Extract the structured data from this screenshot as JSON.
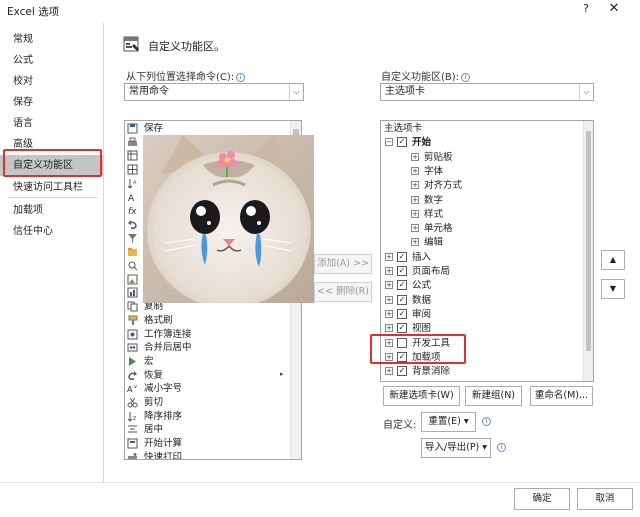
{
  "window": {
    "title": "Excel 选项",
    "help": "?",
    "close": "✕"
  },
  "sidebar": {
    "items": [
      {
        "label": "常规"
      },
      {
        "label": "公式"
      },
      {
        "label": "校对"
      },
      {
        "label": "保存"
      },
      {
        "label": "语言"
      },
      {
        "label": "高级"
      },
      {
        "label": "自定义功能区"
      },
      {
        "label": "快速访问工具栏"
      },
      {
        "label": "加载项"
      },
      {
        "label": "信任中心"
      }
    ],
    "active_index": 6
  },
  "header": {
    "title": "自定义功能区。",
    "icon": "customize-ribbon-icon"
  },
  "left_panel": {
    "label": "从下列位置选择命令(C):",
    "dropdown_value": "常用命令",
    "commands": [
      {
        "label": "保存",
        "icon": "save-icon"
      },
      {
        "label": "",
        "icon": "print-icon"
      },
      {
        "label": "",
        "icon": "table-icon"
      },
      {
        "label": "",
        "icon": "grid-icon"
      },
      {
        "label": "",
        "icon": "sort-icon"
      },
      {
        "label": "",
        "icon": "text-icon"
      },
      {
        "label": "",
        "icon": "function-icon"
      },
      {
        "label": "",
        "icon": "undo-icon"
      },
      {
        "label": "",
        "icon": "filter-icon"
      },
      {
        "label": "",
        "icon": "folder-icon"
      },
      {
        "label": "",
        "icon": "preview-icon"
      },
      {
        "label": "",
        "icon": "image-icon"
      },
      {
        "label": "",
        "icon": "chart-icon"
      },
      {
        "label": "复制",
        "icon": "copy-icon"
      },
      {
        "label": "格式刷",
        "icon": "format-painter-icon"
      },
      {
        "label": "工作簿连接",
        "icon": "connection-icon"
      },
      {
        "label": "合并后居中",
        "icon": "merge-center-icon"
      },
      {
        "label": "宏",
        "icon": "macro-icon"
      },
      {
        "label": "恢复",
        "icon": "redo-icon"
      },
      {
        "label": "减小字号",
        "icon": "decrease-font-icon"
      },
      {
        "label": "剪切",
        "icon": "cut-icon"
      },
      {
        "label": "降序排序",
        "icon": "sort-desc-icon"
      },
      {
        "label": "居中",
        "icon": "align-center-icon"
      },
      {
        "label": "开始计算",
        "icon": "calculate-icon"
      },
      {
        "label": "快速打印",
        "icon": "quick-print-icon"
      }
    ]
  },
  "middle": {
    "add_label": "添加(A) >>",
    "remove_label": "<< 删除(R)"
  },
  "right_panel": {
    "label": "自定义功能区(B):",
    "dropdown_value": "主选项卡",
    "tree": [
      {
        "label": "主选项卡",
        "level": 0,
        "expander": "",
        "check": false,
        "hasCheck": false
      },
      {
        "label": "开始",
        "level": 1,
        "expander": "−",
        "check": true,
        "hasCheck": true,
        "bold": true
      },
      {
        "label": "剪贴板",
        "level": 2,
        "expander": "+",
        "hasCheck": false
      },
      {
        "label": "字体",
        "level": 2,
        "expander": "+",
        "hasCheck": false
      },
      {
        "label": "对齐方式",
        "level": 2,
        "expander": "+",
        "hasCheck": false
      },
      {
        "label": "数字",
        "level": 2,
        "expander": "+",
        "hasCheck": false
      },
      {
        "label": "样式",
        "level": 2,
        "expander": "+",
        "hasCheck": false
      },
      {
        "label": "单元格",
        "level": 2,
        "expander": "+",
        "hasCheck": false
      },
      {
        "label": "编辑",
        "level": 2,
        "expander": "+",
        "hasCheck": false
      },
      {
        "label": "插入",
        "level": 1,
        "expander": "+",
        "check": true,
        "hasCheck": true
      },
      {
        "label": "页面布局",
        "level": 1,
        "expander": "+",
        "check": true,
        "hasCheck": true
      },
      {
        "label": "公式",
        "level": 1,
        "expander": "+",
        "check": true,
        "hasCheck": true
      },
      {
        "label": "数据",
        "level": 1,
        "expander": "+",
        "check": true,
        "hasCheck": true
      },
      {
        "label": "审阅",
        "level": 1,
        "expander": "+",
        "check": true,
        "hasCheck": true
      },
      {
        "label": "视图",
        "level": 1,
        "expander": "+",
        "check": true,
        "hasCheck": true
      },
      {
        "label": "开发工具",
        "level": 1,
        "expander": "+",
        "check": false,
        "hasCheck": true
      },
      {
        "label": "加载项",
        "level": 1,
        "expander": "+",
        "check": true,
        "hasCheck": true
      },
      {
        "label": "背景消除",
        "level": 1,
        "expander": "+",
        "check": true,
        "hasCheck": true
      }
    ],
    "buttons": {
      "new_tab": "新建选项卡(W)",
      "new_group": "新建组(N)",
      "rename": "重命名(M)..."
    },
    "customize_label": "自定义:",
    "reset_label": "重置(E) ▾",
    "import_export_label": "导入/导出(P) ▾"
  },
  "move_buttons": {
    "up": "▲",
    "down": "▼"
  },
  "footer": {
    "ok": "确定",
    "cancel": "取消"
  },
  "colors": {
    "highlight_red": "#e0302e",
    "sidebar_active": "#c5c5c5",
    "help_blue": "#3a6fb8"
  }
}
